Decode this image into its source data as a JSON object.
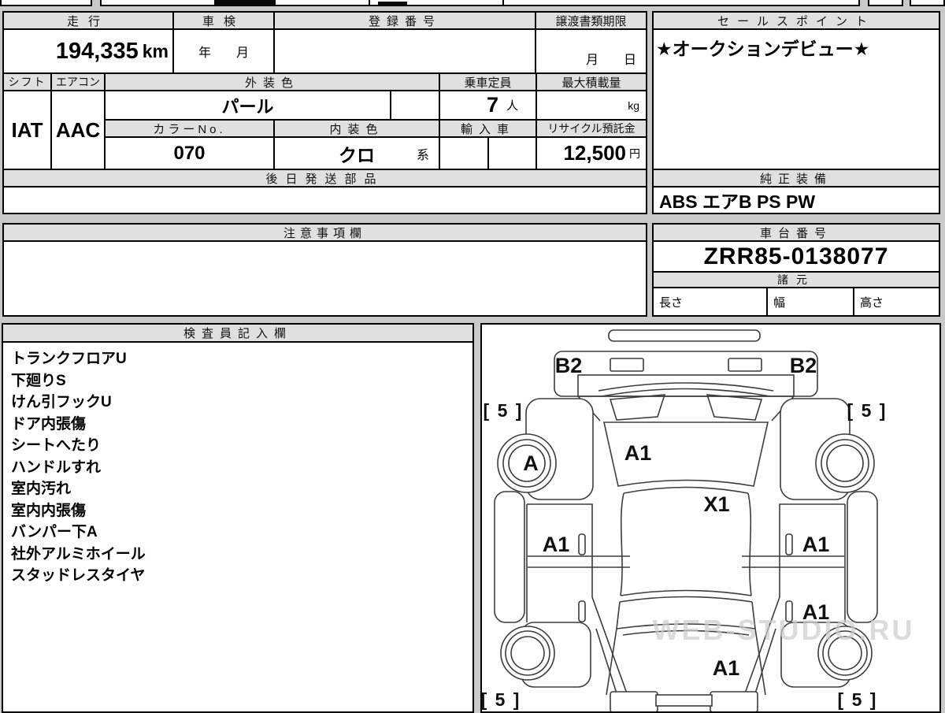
{
  "colors": {
    "page_bg": "#c9c9c9",
    "header_bg": "#e0e0e0",
    "border": "#000000"
  },
  "vehicle_table": {
    "mileage_label": "走行",
    "mileage_value": "194,335",
    "mileage_unit": "km",
    "inspection_label": "車検",
    "inspection_placeholder": "年　　月",
    "registration_label": "登録番号",
    "registration_value": "",
    "transfer_label": "譲渡書類期限",
    "transfer_placeholder": "月　　日",
    "shift_label": "シフト",
    "shift_value": "IAT",
    "aircon_label": "エアコン",
    "aircon_value": "AAC",
    "exterior_color_label": "外装色",
    "exterior_color_value": "パール",
    "capacity_label": "乗車定員",
    "capacity_value": "7",
    "capacity_unit": "人",
    "max_load_label": "最大積載量",
    "max_load_unit": "kg",
    "color_no_label": "カラーNo.",
    "color_no_value": "070",
    "interior_color_label": "内装色",
    "interior_color_value": "クロ",
    "interior_color_suffix": "系",
    "import_label": "輸入車",
    "recycle_label": "リサイクル預託金",
    "recycle_value": "12,500",
    "recycle_unit": "円",
    "later_parts_label": "後日発送部品"
  },
  "sales_point": {
    "label": "セールスポイント",
    "text": "★オークションデビュー★"
  },
  "equipment": {
    "label": "純正装備",
    "text": "ABS エアB PS PW"
  },
  "notes": {
    "label": "注意事項欄"
  },
  "chassis": {
    "label": "車台番号",
    "number": "ZRR85-0138077"
  },
  "specs": {
    "label": "諸元",
    "length_label": "長さ",
    "width_label": "幅",
    "height_label": "高さ"
  },
  "inspector": {
    "label": "検査員記入欄",
    "items": [
      "トランクフロアU",
      "下廻りS",
      "けん引フックU",
      "ドア内張傷",
      "シートへたり",
      "ハンドルすれ",
      "室内汚れ",
      "室内内張傷",
      "バンパー下A",
      "社外アルミホイール",
      "スタッドレスタイヤ"
    ]
  },
  "diagram": {
    "b2_left": "B2",
    "b2_right": "B2",
    "bracket_front_left": "[ 5 ]",
    "bracket_front_right": "[ 5 ]",
    "bracket_rear_left": "[ 5 ]",
    "bracket_rear_right": "[ 5 ]",
    "wheel_a": "A",
    "hood_a1": "A1",
    "cowl_x1": "X1",
    "door_left_a1": "A1",
    "door_right_a1": "A1",
    "quarter_right_a1": "A1",
    "rear_a1": "A1",
    "watermark": "WEB-STUDIO.RU"
  }
}
